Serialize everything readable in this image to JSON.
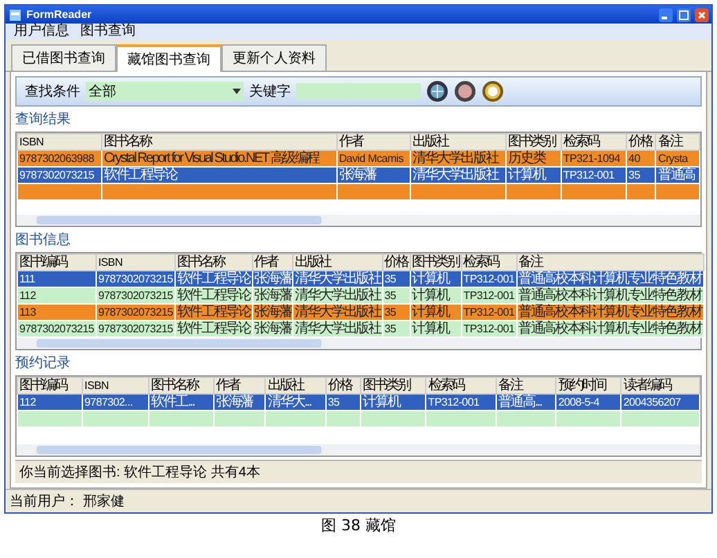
{
  "window": {
    "title": "FormReader"
  },
  "menu": [
    "用户信息",
    "图书查询"
  ],
  "tabs": [
    {
      "label": "已借图书查询",
      "selected": false
    },
    {
      "label": "藏馆图书查询",
      "selected": true
    },
    {
      "label": "更新个人资料",
      "selected": false
    }
  ],
  "search": {
    "condition_label": "查找条件",
    "condition_value": "全部",
    "keyword_label": "关键字"
  },
  "sections": [
    {
      "title": "查询结果",
      "columns": [
        "ISBN",
        "图书名称",
        "作者",
        "出版社",
        "图书类别",
        "检索码",
        "价格",
        "备注"
      ],
      "rows": [
        {
          "kind": "data",
          "selected": false,
          "color": "#f08a24",
          "cells": [
            "9787302063988",
            "Crystal Report for Visual Studio.NET 高级编程",
            "David Mcamis",
            "清华大学出版社",
            "历史类",
            "TP321-1094",
            "40",
            "Crysta"
          ]
        },
        {
          "kind": "data",
          "selected": true,
          "cells": [
            "9787302073215",
            "软件工程导论",
            "张海藩",
            "清华大学出版社",
            "计算机",
            "TP312-001",
            "35",
            "普通高"
          ]
        },
        {
          "kind": "blank",
          "selected": false,
          "color": "#f08a24"
        }
      ]
    },
    {
      "title": "图书信息",
      "columns": [
        "图书编码",
        "ISBN",
        "图书名称",
        "作者",
        "出版社",
        "价格",
        "图书类别",
        "检索码",
        "备注"
      ],
      "rows": [
        {
          "kind": "data",
          "selected": true,
          "cells": [
            "111",
            "9787302073215",
            "软件工程导论",
            "张海藩",
            "清华大学出版社",
            "35",
            "计算机",
            "TP312-001",
            "普通高校本科计算机专业特色教材"
          ]
        },
        {
          "kind": "data",
          "selected": false,
          "color": "#c8f0c8",
          "cells": [
            "112",
            "9787302073215",
            "软件工程导论",
            "张海藩",
            "清华大学出版社",
            "35",
            "计算机",
            "TP312-001",
            "普通高校本科计算机专业特色教材"
          ]
        },
        {
          "kind": "data",
          "selected": false,
          "color": "#f08a24",
          "cells": [
            "113",
            "9787302073215",
            "软件工程导论",
            "张海藩",
            "清华大学出版社",
            "35",
            "计算机",
            "TP312-001",
            "普通高校本科计算机专业特色教材"
          ]
        },
        {
          "kind": "data",
          "selected": false,
          "color": "#c8f0c8",
          "cells": [
            "9787302073215",
            "9787302073215",
            "软件工程导论",
            "张海藩",
            "清华大学出版社",
            "35",
            "计算机",
            "TP312-001",
            "普通高校本科计算机专业特色教材"
          ]
        }
      ]
    },
    {
      "title": "预约记录",
      "columns": [
        "图书编码",
        "ISBN",
        "图书名称",
        "作者",
        "出版社",
        "价格",
        "图书类别",
        "检索码",
        "备注",
        "预约时间",
        "读者编码"
      ],
      "rows": [
        {
          "kind": "data",
          "selected": true,
          "cells": [
            "112",
            "9787302...",
            "软件工...",
            "张海藩",
            "清华大...",
            "35",
            "计算机",
            "TP312-001",
            "普通高...",
            "2008-5-4",
            "2004356207"
          ]
        },
        {
          "kind": "blank",
          "selected": false,
          "color": "#c8f0c8"
        }
      ]
    }
  ],
  "status_line": "你当前选择图书: 软件工程导论  共有4本",
  "status_bar": "当前用户： 邢家健",
  "caption": "图 38  藏馆"
}
